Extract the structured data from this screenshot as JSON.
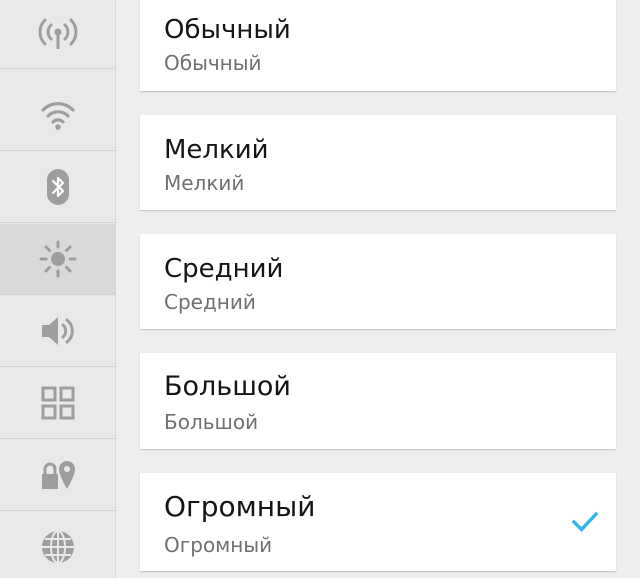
{
  "colors": {
    "accent": "#33b5e5",
    "icon": "#9e9e9e",
    "rail_bg": "#e9e9e9",
    "page_bg": "#eeeeee"
  },
  "rail": {
    "items": [
      {
        "icon": "wireless-tower-icon"
      },
      {
        "icon": "wifi-icon"
      },
      {
        "icon": "bluetooth-icon"
      },
      {
        "icon": "brightness-icon",
        "active": true
      },
      {
        "icon": "volume-icon"
      },
      {
        "icon": "apps-grid-icon"
      },
      {
        "icon": "location-lock-icon"
      },
      {
        "icon": "globe-icon"
      }
    ]
  },
  "options": [
    {
      "title": "Обычный",
      "subtitle": "Обычный",
      "selected": false
    },
    {
      "title": "Мелкий",
      "subtitle": "Мелкий",
      "selected": false
    },
    {
      "title": "Средний",
      "subtitle": "Средний",
      "selected": false
    },
    {
      "title": "Большой",
      "subtitle": "Большой",
      "selected": false
    },
    {
      "title": "Огромный",
      "subtitle": "Огромный",
      "selected": true
    }
  ]
}
